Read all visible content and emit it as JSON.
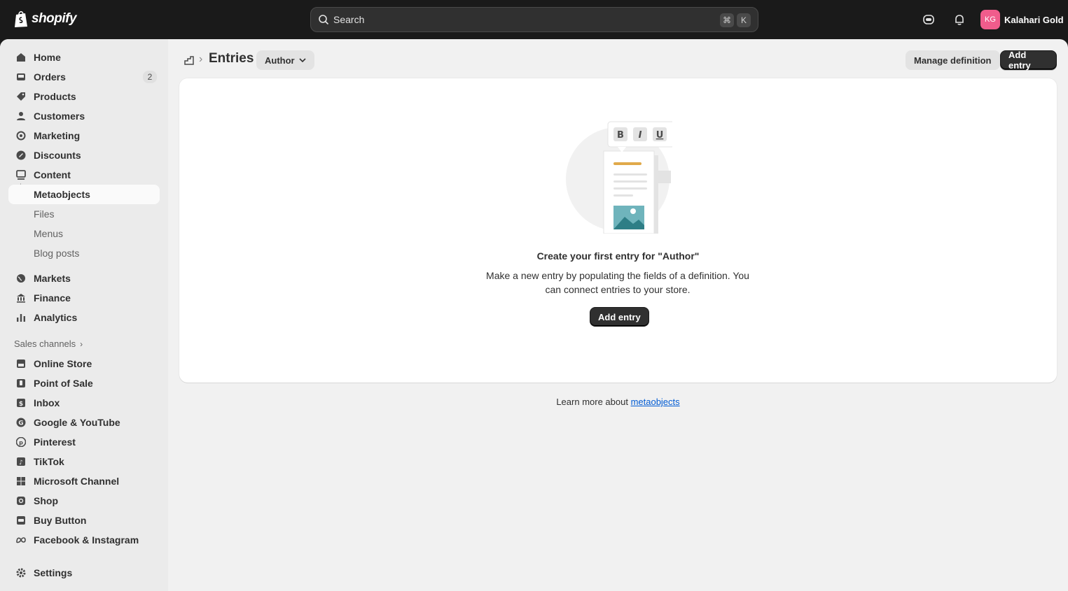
{
  "topbar": {
    "logo_text": "shopify",
    "search_placeholder": "Search",
    "shortcut_key1": "⌘",
    "shortcut_key2": "K",
    "avatar_initials": "KG",
    "store_name": "Kalahari Gold"
  },
  "sidebar": {
    "items": [
      {
        "label": "Home"
      },
      {
        "label": "Orders",
        "badge": "2"
      },
      {
        "label": "Products"
      },
      {
        "label": "Customers"
      },
      {
        "label": "Marketing"
      },
      {
        "label": "Discounts"
      },
      {
        "label": "Content"
      }
    ],
    "content_sub": [
      "Metaobjects",
      "Files",
      "Menus",
      "Blog posts"
    ],
    "items2": [
      {
        "label": "Markets"
      },
      {
        "label": "Finance"
      },
      {
        "label": "Analytics"
      }
    ],
    "sales_channels_label": "Sales channels",
    "channels": [
      {
        "label": "Online Store"
      },
      {
        "label": "Point of Sale"
      },
      {
        "label": "Inbox"
      },
      {
        "label": "Google & YouTube"
      },
      {
        "label": "Pinterest"
      },
      {
        "label": "TikTok"
      },
      {
        "label": "Microsoft Channel"
      },
      {
        "label": "Shop"
      },
      {
        "label": "Buy Button"
      },
      {
        "label": "Facebook & Instagram"
      }
    ],
    "settings_label": "Settings"
  },
  "header": {
    "title": "Entries",
    "type_select": "Author",
    "manage_button": "Manage definition",
    "add_button": "Add entry"
  },
  "empty_state": {
    "title": "Create your first entry for \"Author\"",
    "body": "Make a new entry by populating the fields of a definition. You can connect entries to your store.",
    "button": "Add entry"
  },
  "footer": {
    "prefix": "Learn more about ",
    "link": "metaobjects"
  },
  "colors": {
    "topbar_bg": "#1a1a1a",
    "avatar": "#f05c8c",
    "primary_button": "#303030",
    "link": "#005bd3"
  }
}
